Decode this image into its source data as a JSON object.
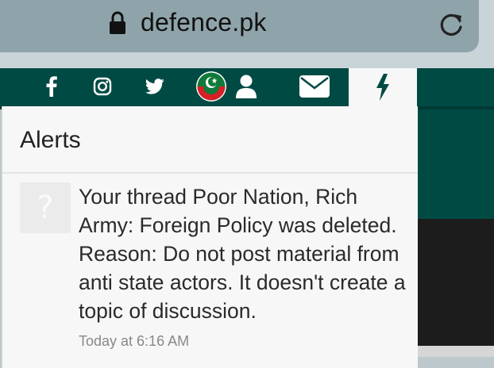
{
  "browser": {
    "url": "defence.pk",
    "lock_icon": "lock-icon",
    "reload_icon": "reload-icon"
  },
  "navbar": {
    "icons": [
      "facebook-icon",
      "instagram-icon",
      "twitter-icon",
      "pti-flag-avatar",
      "user-icon",
      "mail-icon",
      "alerts-bolt-icon"
    ],
    "accent": "#004a44"
  },
  "alerts_panel": {
    "title": "Alerts",
    "items": [
      {
        "avatar_glyph": "?",
        "message": "Your thread Poor Nation, Rich Army: Foreign Policy was deleted. Reason: Do not post material from anti state actors. It doesn't create a topic of discussion.",
        "time": "Today at 6:16 AM"
      }
    ]
  }
}
